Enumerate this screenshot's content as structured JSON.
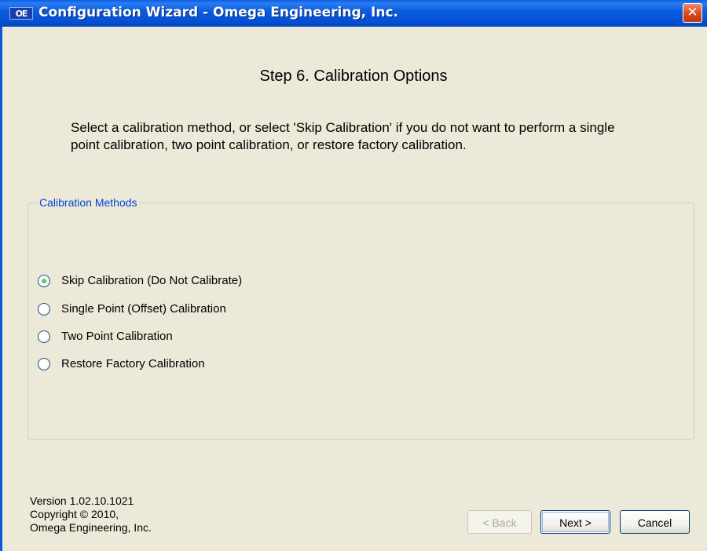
{
  "window": {
    "title": "Configuration Wizard - Omega Engineering, Inc.",
    "app_icon_text": "OE",
    "close_glyph": "✕"
  },
  "step_title": "Step 6.  Calibration Options",
  "instructions": "Select a calibration method, or select 'Skip Calibration' if you do not want to perform a single point calibration, two point calibration, or restore factory calibration.",
  "group": {
    "legend": "Calibration Methods",
    "options": [
      {
        "label": "Skip Calibration (Do Not Calibrate)",
        "selected": true
      },
      {
        "label": "Single Point (Offset) Calibration",
        "selected": false
      },
      {
        "label": "Two Point Calibration",
        "selected": false
      },
      {
        "label": "Restore Factory Calibration",
        "selected": false
      }
    ]
  },
  "footer": {
    "version": "Version 1.02.10.1021",
    "copyright": "Copyright © 2010,",
    "company": "Omega Engineering, Inc."
  },
  "buttons": {
    "back": "< Back",
    "next": "Next >",
    "cancel": "Cancel"
  },
  "colors": {
    "titlebar": "#0552d6",
    "dialog_bg": "#ece9d8",
    "group_legend": "#0046d5",
    "radio_selected": "#21a121"
  }
}
